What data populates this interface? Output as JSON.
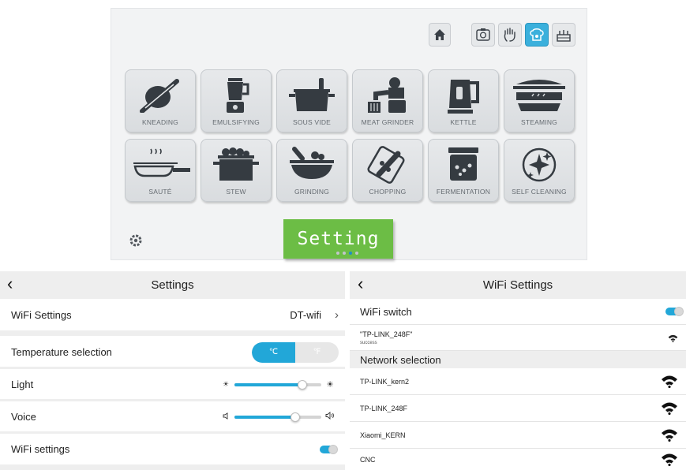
{
  "cook_screen": {
    "top_icons": [
      "home-icon",
      "recipe-icon",
      "hand-icon",
      "chef-icon",
      "cake-icon"
    ],
    "active_icon": "chef-icon",
    "modes": [
      {
        "label": "KNEADING",
        "icon": "rolling-pin-icon"
      },
      {
        "label": "EMULSIFYING",
        "icon": "blender-icon"
      },
      {
        "label": "SOUS VIDE",
        "icon": "sous-vide-pot-icon"
      },
      {
        "label": "MEAT GRINDER",
        "icon": "meat-grinder-icon"
      },
      {
        "label": "KETTLE",
        "icon": "kettle-icon"
      },
      {
        "label": "STEAMING",
        "icon": "steamer-icon"
      },
      {
        "label": "SAUTÉ",
        "icon": "frying-pan-icon"
      },
      {
        "label": "STEW",
        "icon": "stew-pot-icon"
      },
      {
        "label": "GRINDING",
        "icon": "mortar-pestle-icon"
      },
      {
        "label": "CHOPPING",
        "icon": "cutting-board-icon"
      },
      {
        "label": "FERMENTATION",
        "icon": "jar-icon"
      },
      {
        "label": "SELF CLEANING",
        "icon": "sparkle-clean-icon"
      }
    ],
    "setting_label": "Setting",
    "page_dots": 4,
    "active_dot": 2
  },
  "settings": {
    "title": "Settings",
    "wifi_label": "WiFi Settings",
    "wifi_value": "DT-wifi",
    "temperature_label": "Temperature selection",
    "unit_c": "℃",
    "unit_f": "℉",
    "light_label": "Light",
    "light_level": 0.78,
    "voice_label": "Voice",
    "voice_level": 0.7,
    "wifi_settings_label": "WiFi settings",
    "wifi_settings_on": true
  },
  "wifi": {
    "title": "WiFi Settings",
    "switch_label": "WiFi switch",
    "connected_name": "\"TP-LINK_248F\"",
    "connected_status": "success",
    "section_label": "Network selection",
    "networks": [
      "TP-LINK_kern2",
      "TP-LINK_248F",
      "Xiaomi_KERN",
      "CNC"
    ]
  },
  "colors": {
    "accent": "#22a7d8",
    "setting_green": "#6cbd45"
  }
}
